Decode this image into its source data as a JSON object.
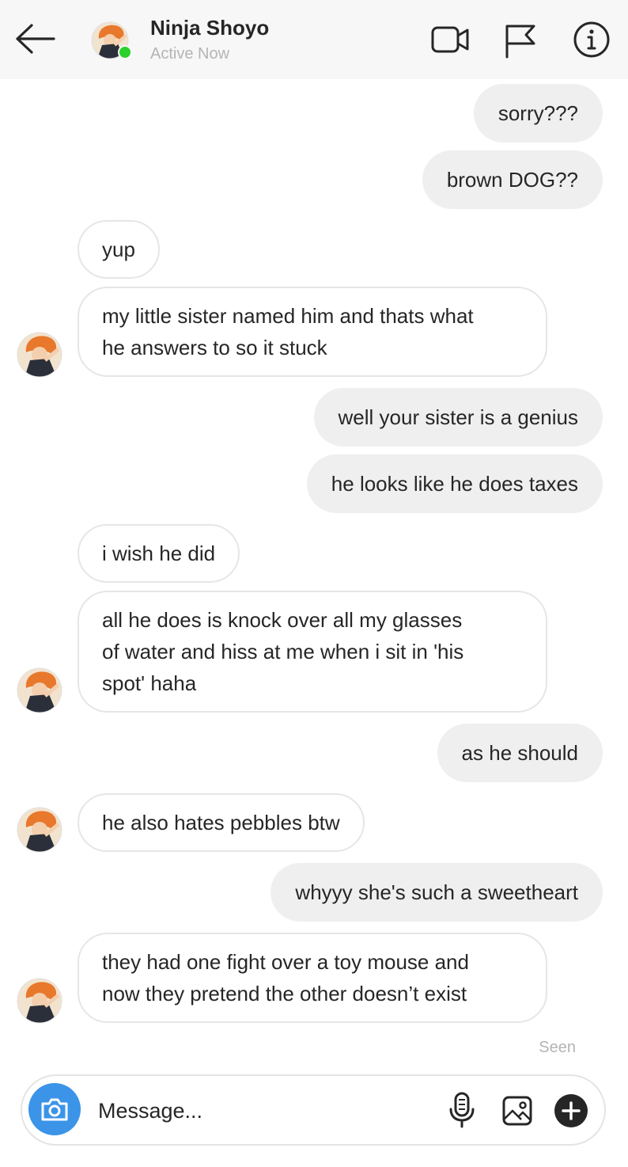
{
  "header": {
    "contact_name": "Ninja Shoyo",
    "status": "Active Now",
    "icons": [
      "back-arrow-icon",
      "video-call-icon",
      "flag-icon",
      "info-icon"
    ]
  },
  "messages": [
    {
      "dir": "out",
      "text": "sorry???"
    },
    {
      "dir": "out",
      "text": "brown DOG??"
    },
    {
      "dir": "in",
      "text": "yup"
    },
    {
      "dir": "in",
      "text": "my little sister named him and thats what\nhe answers to so it stuck"
    },
    {
      "dir": "out",
      "text": "well your sister is a genius"
    },
    {
      "dir": "out",
      "text": "he looks like he does taxes"
    },
    {
      "dir": "in",
      "text": "i wish he did"
    },
    {
      "dir": "in",
      "text": "all he does is knock over all my glasses\nof water and hiss at me when i sit in 'his\nspot' haha"
    },
    {
      "dir": "out",
      "text": "as he should"
    },
    {
      "dir": "in",
      "text": "he also hates pebbles btw"
    },
    {
      "dir": "out",
      "text": "whyyy she's such a sweetheart"
    },
    {
      "dir": "in",
      "text": "they had one fight over a toy mouse and\nnow they pretend the other doesn’t exist"
    }
  ],
  "seen_label": "Seen",
  "composer": {
    "placeholder": "Message...",
    "icons": [
      "camera-icon",
      "microphone-icon",
      "gallery-icon",
      "plus-icon"
    ]
  },
  "colors": {
    "outgoing_bubble": "#efefef",
    "incoming_border": "#e6e6e6",
    "online": "#2cd02c",
    "camera_button": "#3b94e8"
  }
}
